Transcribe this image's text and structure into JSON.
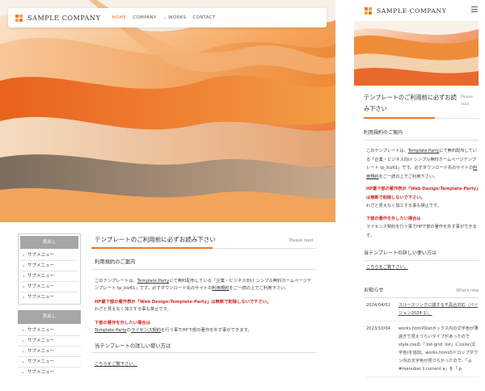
{
  "brand": {
    "name": "SAMPLE COMPANY",
    "logo_colors": [
      "#e8792b",
      "#f3a552",
      "#f3a552",
      "#e8792b"
    ]
  },
  "nav": {
    "items": [
      {
        "label": "HOME",
        "active": true
      },
      {
        "label": "COMPANY"
      },
      {
        "label": "WORKS",
        "has_dropdown": true
      },
      {
        "label": "CONTACT"
      }
    ]
  },
  "sidebar": {
    "box1": {
      "heading": "見出し",
      "items": [
        "サブメニュー",
        "サブメニュー",
        "サブメニュー",
        "サブメニュー",
        "サブメニュー"
      ]
    },
    "box2": {
      "heading": "見出し",
      "items": [
        "サブメニュー",
        "サブメニュー",
        "サブメニュー",
        "サブメニュー",
        "サブメニュー"
      ]
    }
  },
  "main": {
    "title": "テンプレートのご利用前に必ずお読み下さい",
    "title_sub": "Please read",
    "section1_heading": "利用規約のご案内",
    "p1": {
      "t1": "このテンプレートは、",
      "link1": "Template Party",
      "t2": "にて無料配布している「企業・ビジネス向け シンプル無料ホームページテンプレート tp_biz61」です。必ずダウンロード先のサイトの",
      "link2": "利用規約",
      "t3": "をご一読の上でご利用下さい。"
    },
    "p2": {
      "red": "HP最下部の著作表示『Web Design:Template-Party』は無断で削除しないで下さい。",
      "normal": "わざと見えなく加工する事も禁止です。"
    },
    "p3": {
      "red": "下部の著作を外したい場合は",
      "link1": "Template-Party",
      "t1": "の",
      "link2": "ライセンス契約",
      "t2": "を行う事でHP下部の著作を外す事ができます。"
    },
    "section2_heading": "当テンプレートの詳しい使い方は",
    "section2_link": "こちらをご覧下さい。"
  },
  "mobile": {
    "title": "テンプレートのご利用前に必ずお読み下さい",
    "title_sub": "Please read",
    "section1_heading": "利用規約のご案内",
    "p1": {
      "t1": "このテンプレートは、",
      "link1": "Template Party",
      "t2": "にて無料配布している「企業・ビジネス向け シンプル無料ホームページテンプレート tp_biz61」です。必ずダウンロード先のサイトの",
      "link2": "利用規約",
      "t3": "をご一読の上でご利用下さい。"
    },
    "p2": {
      "red": "HP最下部の著作表示『Web Design:Template-Party』は無断で削除しないで下さい。",
      "normal": "わざと見えなく加工する事も禁止です。"
    },
    "p3": {
      "red": "下部の著作を外したい場合は",
      "normal": "ライセンス契約を行う事でHP下部の著作を外す事ができます。"
    },
    "section2_heading": "当テンプレートの詳しい使い方は",
    "section2_link": "こちらをご覧下さい。",
    "news": {
      "title": "お知らせ",
      "sub": "What's new",
      "items": [
        {
          "date": "2024/04/01",
          "text": "スルースリンクに関する不具合対応（バージョン2024-1）。",
          "is_link": true
        },
        {
          "date": "2023/10/04",
          "text": "works.html内listボックス内の文字色が薄過ぎて見えづらいタイプがあったのでstyle.cssの「.list-grid .list」にcolor(文字色)を追加。works.htmlのドロップダウン内の文字色が見づらかったので、「.p #menubar li.current a」を「.p"
        }
      ]
    }
  },
  "colors": {
    "accent": "#e8792b",
    "red_text": "#d32a2a",
    "sidebar_head": "#a6a6a6"
  }
}
